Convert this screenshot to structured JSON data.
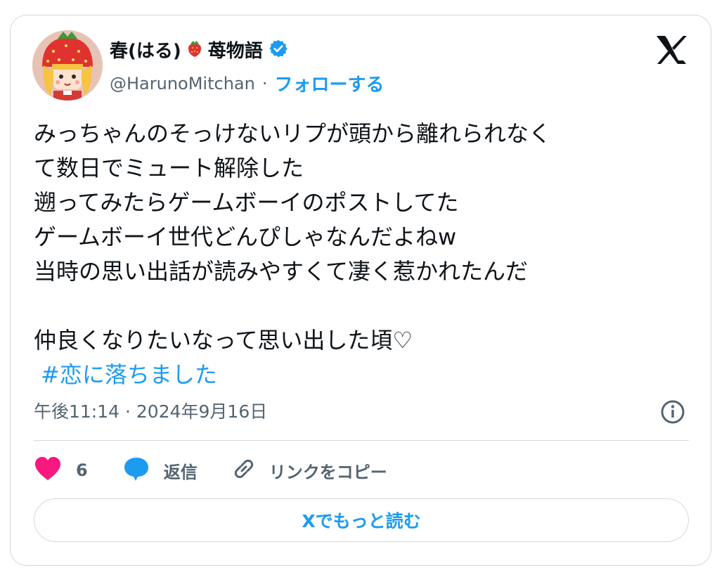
{
  "author": {
    "display_name": "春(はる)",
    "emoji_icon": "strawberry-icon",
    "name_suffix": "苺物語",
    "verified_icon": "verified-badge-icon",
    "handle": "@HarunoMitchan",
    "separator": "·",
    "follow_label": "フォローする"
  },
  "platform_logo": "x-logo-icon",
  "tweet": {
    "lines": [
      "みっちゃんのそっけないリプが頭から離れられなく",
      "て数日でミュート解除した",
      "遡ってみたらゲームボーイのポストしてた",
      "ゲームボーイ世代どんぴしゃなんだよねw",
      "当時の思い出話が読みやすくて凄く惹かれたんだ",
      "仲良くなりたいなって思い出した頃♡"
    ],
    "hashtag": "#恋に落ちました"
  },
  "timestamp": "午後11:14 · 2024年9月16日",
  "info_icon": "info-icon",
  "actions": {
    "like_count": "6",
    "reply_label": "返信",
    "copy_link_label": "リンクをコピー"
  },
  "read_more_label": "Xでもっと読む",
  "colors": {
    "accent": "#1d9bf0",
    "heart": "#f91880",
    "text": "#0f1419",
    "secondary": "#536471",
    "border": "#cfd9de"
  }
}
